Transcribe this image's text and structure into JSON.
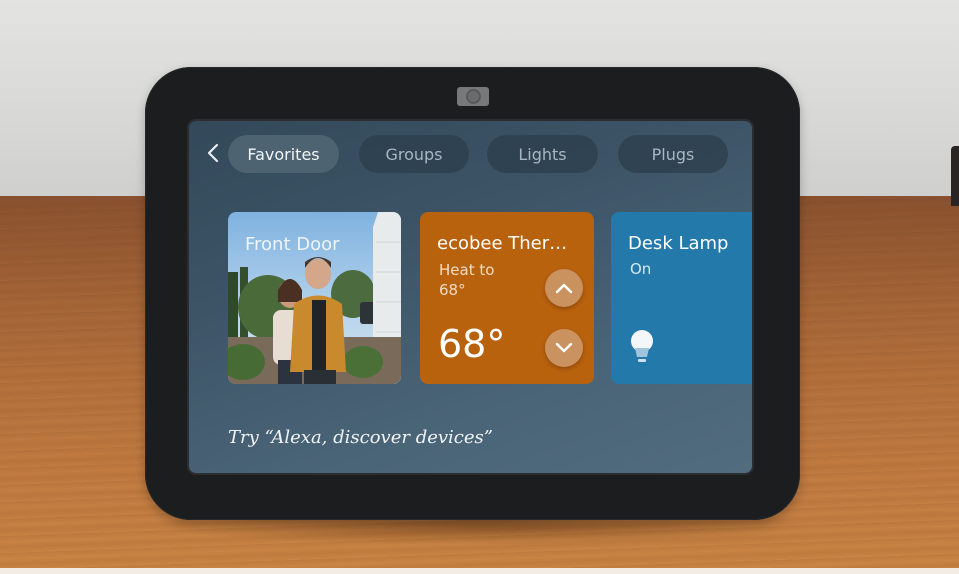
{
  "device": {
    "camera_icon": "camera-shutter-icon"
  },
  "navigation": {
    "back_icon": "chevron-left-icon",
    "back_glyph": "‹",
    "tabs": [
      {
        "label": "Favorites",
        "active": true
      },
      {
        "label": "Groups",
        "active": false
      },
      {
        "label": "Lights",
        "active": false
      },
      {
        "label": "Plugs",
        "active": false
      }
    ]
  },
  "cards": {
    "front_door": {
      "title": "Front Door",
      "type": "camera-feed"
    },
    "thermostat": {
      "title": "ecobee Ther…",
      "mode_line1": "Heat to",
      "mode_line2": "68°",
      "current_temp": "68°",
      "up_icon": "chevron-up-icon",
      "down_icon": "chevron-down-icon",
      "color": "#b9620e"
    },
    "desk_lamp": {
      "title": "Desk Lamp",
      "state": "On",
      "icon": "light-bulb-icon",
      "color": "#2379a9"
    }
  },
  "hint": "Try “Alexa, discover devices”"
}
